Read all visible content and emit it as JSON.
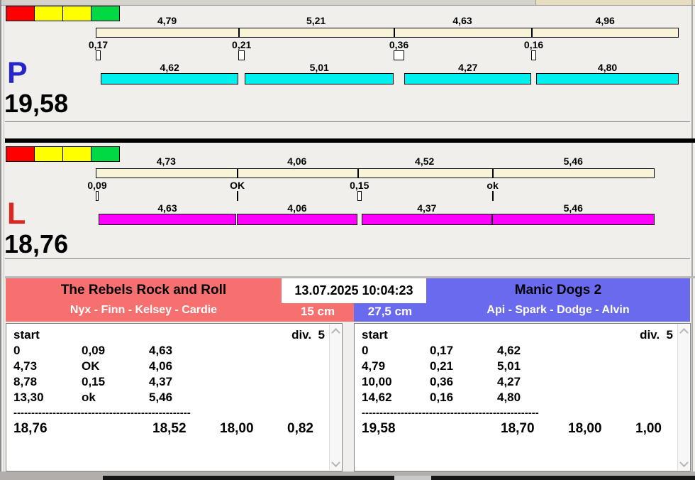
{
  "colors": {
    "bar_beige": "#f8f4d8",
    "bar_cyan": "#00efef",
    "bar_magenta": "#fb00fb",
    "status_red": "#ff0000",
    "status_yellow": "#ffff00",
    "status_green": "#00d944",
    "team_left_bg": "#f77070",
    "team_right_bg": "#6a6aee",
    "letter_p_color": "#2626cc",
    "letter_l_color": "#e02520"
  },
  "panels": [
    {
      "letter": "P",
      "letter_color": "#2626cc",
      "total_label": "19,58",
      "total_value": 19.58,
      "bar_color": "#00efef",
      "status_lights": [
        "#ff0000",
        "#ffff00",
        "#ffff00",
        "#00d944"
      ],
      "starts": [
        0,
        4.79,
        10.0,
        14.62
      ],
      "splits": [
        "4,79",
        "5,21",
        "4,63",
        "4,96"
      ],
      "exchanges": [
        {
          "label": "0,17",
          "value": 0.17,
          "ok": false
        },
        {
          "label": "0,21",
          "value": 0.21,
          "ok": false
        },
        {
          "label": "0,36",
          "value": 0.36,
          "ok": false
        },
        {
          "label": "0,16",
          "value": 0.16,
          "ok": false
        }
      ],
      "runs": [
        {
          "label": "4,62",
          "value": 4.62
        },
        {
          "label": "5,01",
          "value": 5.01
        },
        {
          "label": "4,27",
          "value": 4.27
        },
        {
          "label": "4,80",
          "value": 4.8
        }
      ]
    },
    {
      "letter": "L",
      "letter_color": "#e02520",
      "total_label": "18,76",
      "total_value": 18.76,
      "bar_color": "#fb00fb",
      "status_lights": [
        "#ff0000",
        "#ffff00",
        "#ffff00",
        "#00d944"
      ],
      "starts": [
        0,
        4.73,
        8.78,
        13.3
      ],
      "splits": [
        "4,73",
        "4,06",
        "4,52",
        "5,46"
      ],
      "exchanges": [
        {
          "label": "0,09",
          "value": 0.09,
          "ok": false
        },
        {
          "label": "OK",
          "value": 0,
          "ok": true
        },
        {
          "label": "0,15",
          "value": 0.15,
          "ok": false
        },
        {
          "label": "ok",
          "value": 0,
          "ok": true
        }
      ],
      "runs": [
        {
          "label": "4,63",
          "value": 4.63
        },
        {
          "label": "4,06",
          "value": 4.06
        },
        {
          "label": "4,37",
          "value": 4.37
        },
        {
          "label": "5,46",
          "value": 5.46
        }
      ]
    }
  ],
  "scoreboard": {
    "datetime": "13.07.2025 10:04:23",
    "left_team": {
      "name": "The Rebels Rock and Roll",
      "members": "Nyx - Finn - Kelsey - Cardie",
      "height": "15 cm",
      "bg": "#f77070",
      "table": {
        "header": "start",
        "division": "div.  5",
        "rows": [
          [
            "0",
            "0,09",
            "4,63"
          ],
          [
            "4,73",
            "OK",
            "4,06"
          ],
          [
            "8,78",
            "0,15",
            "4,37"
          ],
          [
            "13,30",
            "ok",
            "5,46"
          ]
        ],
        "separator": "--------------------------------------------------",
        "totals": [
          "18,76",
          "18,52",
          "18,00",
          "0,82"
        ]
      }
    },
    "right_team": {
      "name": "Manic Dogs 2",
      "members": "Api - Spark - Dodge - Alvin",
      "height": "27,5 cm",
      "bg": "#6a6aee",
      "table": {
        "header": "start",
        "division": "div.  5",
        "rows": [
          [
            "0",
            "0,17",
            "4,62"
          ],
          [
            "4,79",
            "0,21",
            "5,01"
          ],
          [
            "10,00",
            "0,36",
            "4,27"
          ],
          [
            "14,62",
            "0,16",
            "4,80"
          ]
        ],
        "separator": "--------------------------------------------------",
        "totals": [
          "19,58",
          "18,70",
          "18,00",
          "1,00"
        ]
      }
    }
  }
}
